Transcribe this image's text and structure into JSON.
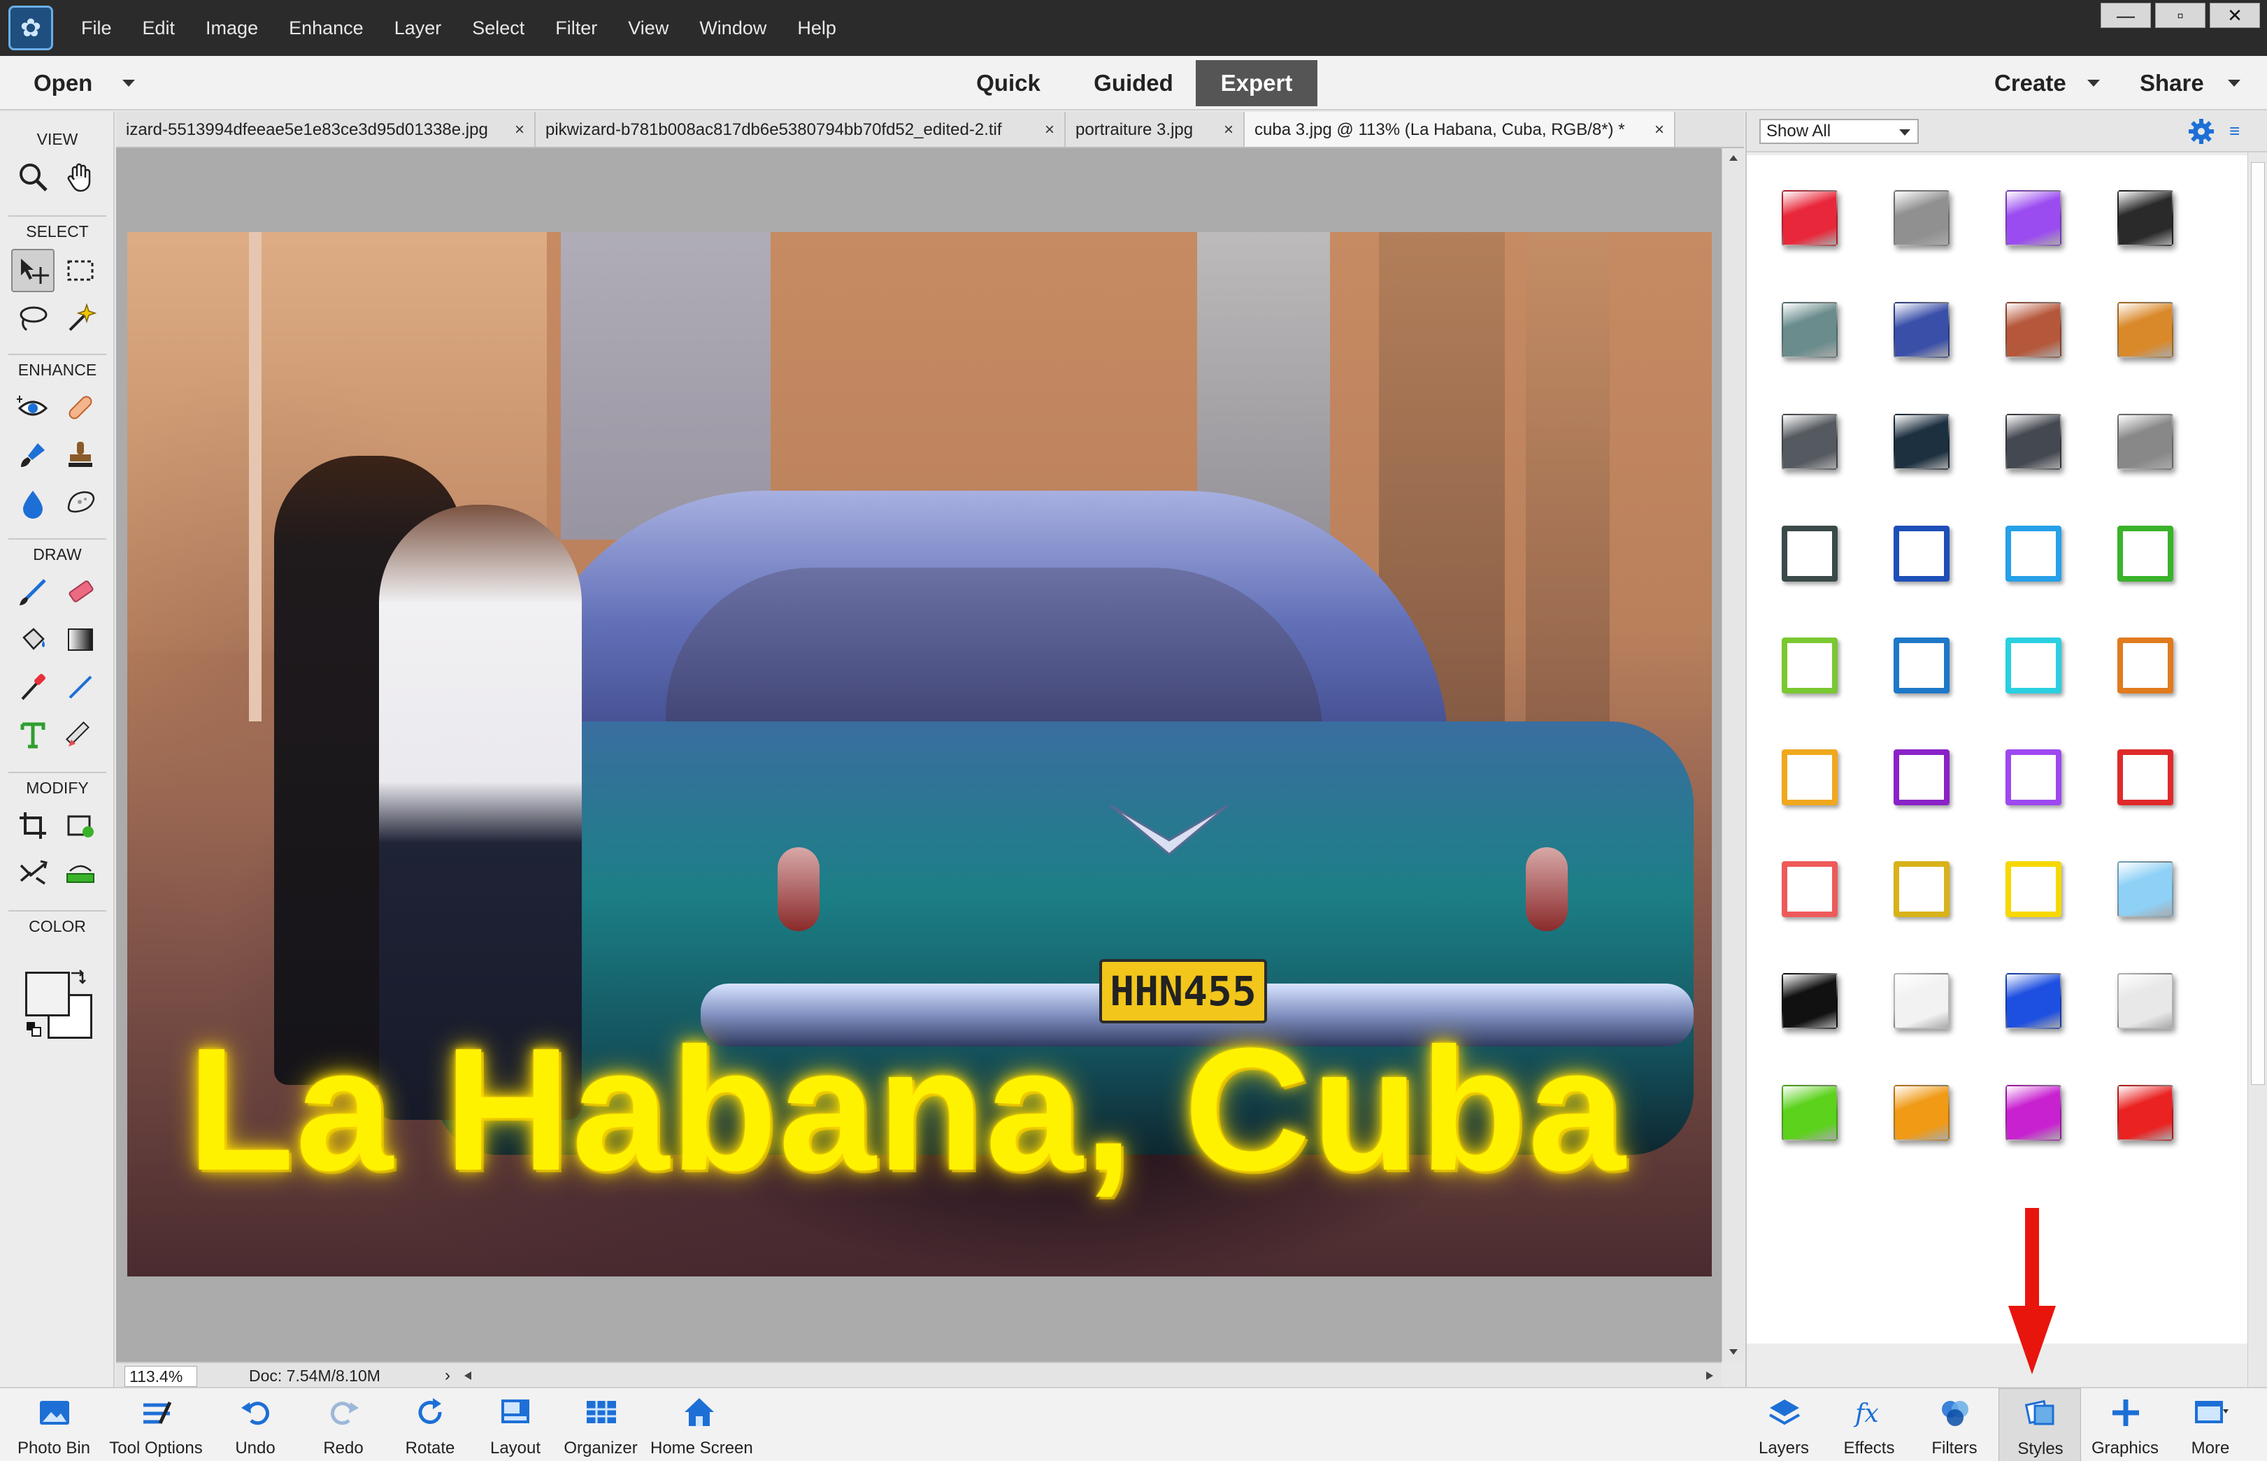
{
  "menubar": {
    "items": [
      "File",
      "Edit",
      "Image",
      "Enhance",
      "Layer",
      "Select",
      "Filter",
      "View",
      "Window",
      "Help"
    ],
    "win_controls": [
      "—",
      "▫",
      "✕"
    ]
  },
  "modebar": {
    "open_label": "Open",
    "modes": [
      "Quick",
      "Guided",
      "Expert"
    ],
    "active_mode": "Expert",
    "create_label": "Create",
    "share_label": "Share"
  },
  "toolbox": {
    "sections": [
      "VIEW",
      "SELECT",
      "ENHANCE",
      "DRAW",
      "MODIFY",
      "COLOR"
    ]
  },
  "doc_tabs": [
    {
      "title": "izard-5513994dfeeae5e1e83ce3d95d01338e.jpg",
      "close": "×"
    },
    {
      "title": "pikwizard-b781b008ac817db6e5380794bb70fd52_edited-2.tif",
      "close": "×"
    },
    {
      "title": "portraiture 3.jpg",
      "close": "×"
    },
    {
      "title": "cuba 3.jpg @ 113% (La Habana, Cuba, RGB/8*) *",
      "close": "×",
      "active": true
    }
  ],
  "tabs_more": ">>",
  "canvas": {
    "overlay_text": "La Habana, Cuba",
    "plate_text": "HHN455"
  },
  "status": {
    "zoom": "113.4%",
    "doc_size": "Doc: 7.54M/8.10M",
    "arrow": "›"
  },
  "panel": {
    "filter_value": "Show All",
    "menu_glyph": "≡",
    "style_swatches": [
      [
        "#e8283a",
        "#909090",
        "#9b4cf0",
        "#2a2a2a"
      ],
      [
        "#6a8c8c",
        "#3a4fa8",
        "#b5573a",
        "#d9892a"
      ],
      [
        "#555a60",
        "#1d3040",
        "#444850",
        "#888888"
      ],
      [
        "#3a4a48",
        "#1e4fb8",
        "#26a0e8",
        "#3ab32a"
      ],
      [
        "#7ac832",
        "#1e78c8",
        "#2ad0e0",
        "#e07b1e"
      ],
      [
        "#f0a81e",
        "#8a22c8",
        "#9e48f0",
        "#e02a2a"
      ],
      [
        "#ee5a5a",
        "#d8b21a",
        "#f6d800",
        "#8ed0f6"
      ],
      [
        "#111111",
        "#f2f2f2",
        "#1d4fe0",
        "#e8e8e8"
      ],
      [
        "#5cd21c",
        "#f09a16",
        "#c822d0",
        "#ea2222"
      ]
    ]
  },
  "bottom_bar": {
    "left": [
      "Photo Bin",
      "Tool Options",
      "Undo",
      "Redo",
      "Rotate",
      "Layout",
      "Organizer",
      "Home Screen"
    ],
    "right": [
      "Layers",
      "Effects",
      "Filters",
      "Styles",
      "Graphics",
      "More"
    ],
    "active": "Styles"
  },
  "colors": {
    "accent": "#1d6fd6",
    "annotation_arrow": "#e8150d",
    "overlay_text": "#fff200"
  }
}
